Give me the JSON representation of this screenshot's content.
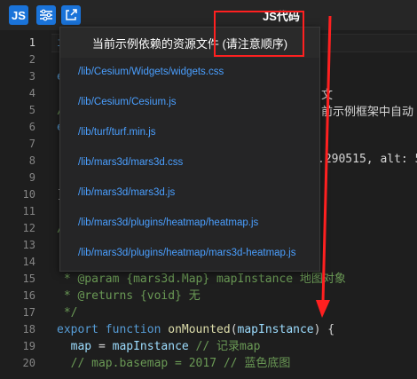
{
  "toolbar": {
    "js_label": "JS",
    "settings_icon": "sliders-icon",
    "link_icon": "external-link-icon",
    "title": "JS代码"
  },
  "gutter": {
    "line_numbers": [
      "1",
      "2",
      "3",
      "4",
      "5",
      "6",
      "7",
      "8",
      "9",
      "10",
      "11",
      "12",
      "13",
      "14",
      "15",
      "16",
      "17",
      "18",
      "19",
      "20"
    ]
  },
  "code": {
    "line1": "i",
    "line3": "e",
    "line5": "/",
    "line6": "e",
    "line8_frag": ".290515, alt: 5",
    "line5_frag": "前示例框架中自动",
    "line3_frag": "文",
    "line10": "]",
    "line12": "/",
    "line15": " * @param {mars3d.Map} mapInstance 地图对象",
    "line16": " * @returns {void} 无",
    "line17": " */",
    "line18_kw": "export",
    "line18_kw2": "function",
    "line18_fn": "onMounted",
    "line18_param": "mapInstance",
    "line18_rest": ") {",
    "line19_var": "map",
    "line19_eq": " = ",
    "line19_val": "mapInstance",
    "line19_cm": " // 记录map",
    "line20_cm": "// map.basemap = 2017 // 蓝色底图"
  },
  "popup": {
    "title": "当前示例依赖的资源文件 (请注意顺序)",
    "items": [
      "/lib/Cesium/Widgets/widgets.css",
      "/lib/Cesium/Cesium.js",
      "/lib/turf/turf.min.js",
      "/lib/mars3d/mars3d.css",
      "/lib/mars3d/mars3d.js",
      "/lib/mars3d/plugins/heatmap/heatmap.js",
      "/lib/mars3d/plugins/heatmap/mars3d-heatmap.js"
    ]
  },
  "colors": {
    "accent": "#1a73d9",
    "highlight": "#ff2020",
    "link": "#4a9fff"
  }
}
